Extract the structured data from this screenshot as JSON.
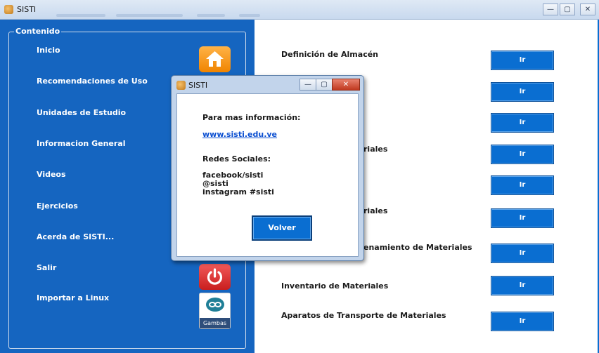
{
  "window": {
    "title": "SISTI",
    "controls": {
      "minimize": "—",
      "maximize": "▢",
      "close": "✕"
    }
  },
  "sidebar": {
    "group_label": "Contenido",
    "items": [
      {
        "label": "Inicio",
        "icon": "home-icon"
      },
      {
        "label": "Recomendaciones de Uso"
      },
      {
        "label": "Unidades de Estudio"
      },
      {
        "label": "Informacion General"
      },
      {
        "label": "Videos"
      },
      {
        "label": "Ejercicios"
      },
      {
        "label": "Acerda de SISTI..."
      },
      {
        "label": "Salir",
        "icon": "power-icon"
      },
      {
        "label": "Importar a Linux",
        "icon": "gambas-icon"
      }
    ],
    "gambas_icon_text": "Gambas"
  },
  "content": {
    "topics": [
      "Definición de Almacén",
      "riales",
      "riales",
      "enamiento de Materiales",
      "Inventario de Materiales",
      "Aparatos de Transporte de Materiales"
    ],
    "button_label": "Ir"
  },
  "dialog": {
    "title": "SISTI",
    "info_label": "Para mas información:",
    "link": "www.sisti.edu.ve",
    "social_label": "Redes Sociales:",
    "social_lines": [
      "facebook/sisti",
      "@sisti",
      "instagram #sisti"
    ],
    "back_button": "Volver",
    "controls": {
      "minimize": "—",
      "maximize": "▢",
      "close": "✕"
    }
  },
  "colors": {
    "sidebar_bg": "#1565c0",
    "button_blue": "#0a6ed1",
    "home_icon": "#f08400",
    "power_icon": "#c91e1e"
  }
}
